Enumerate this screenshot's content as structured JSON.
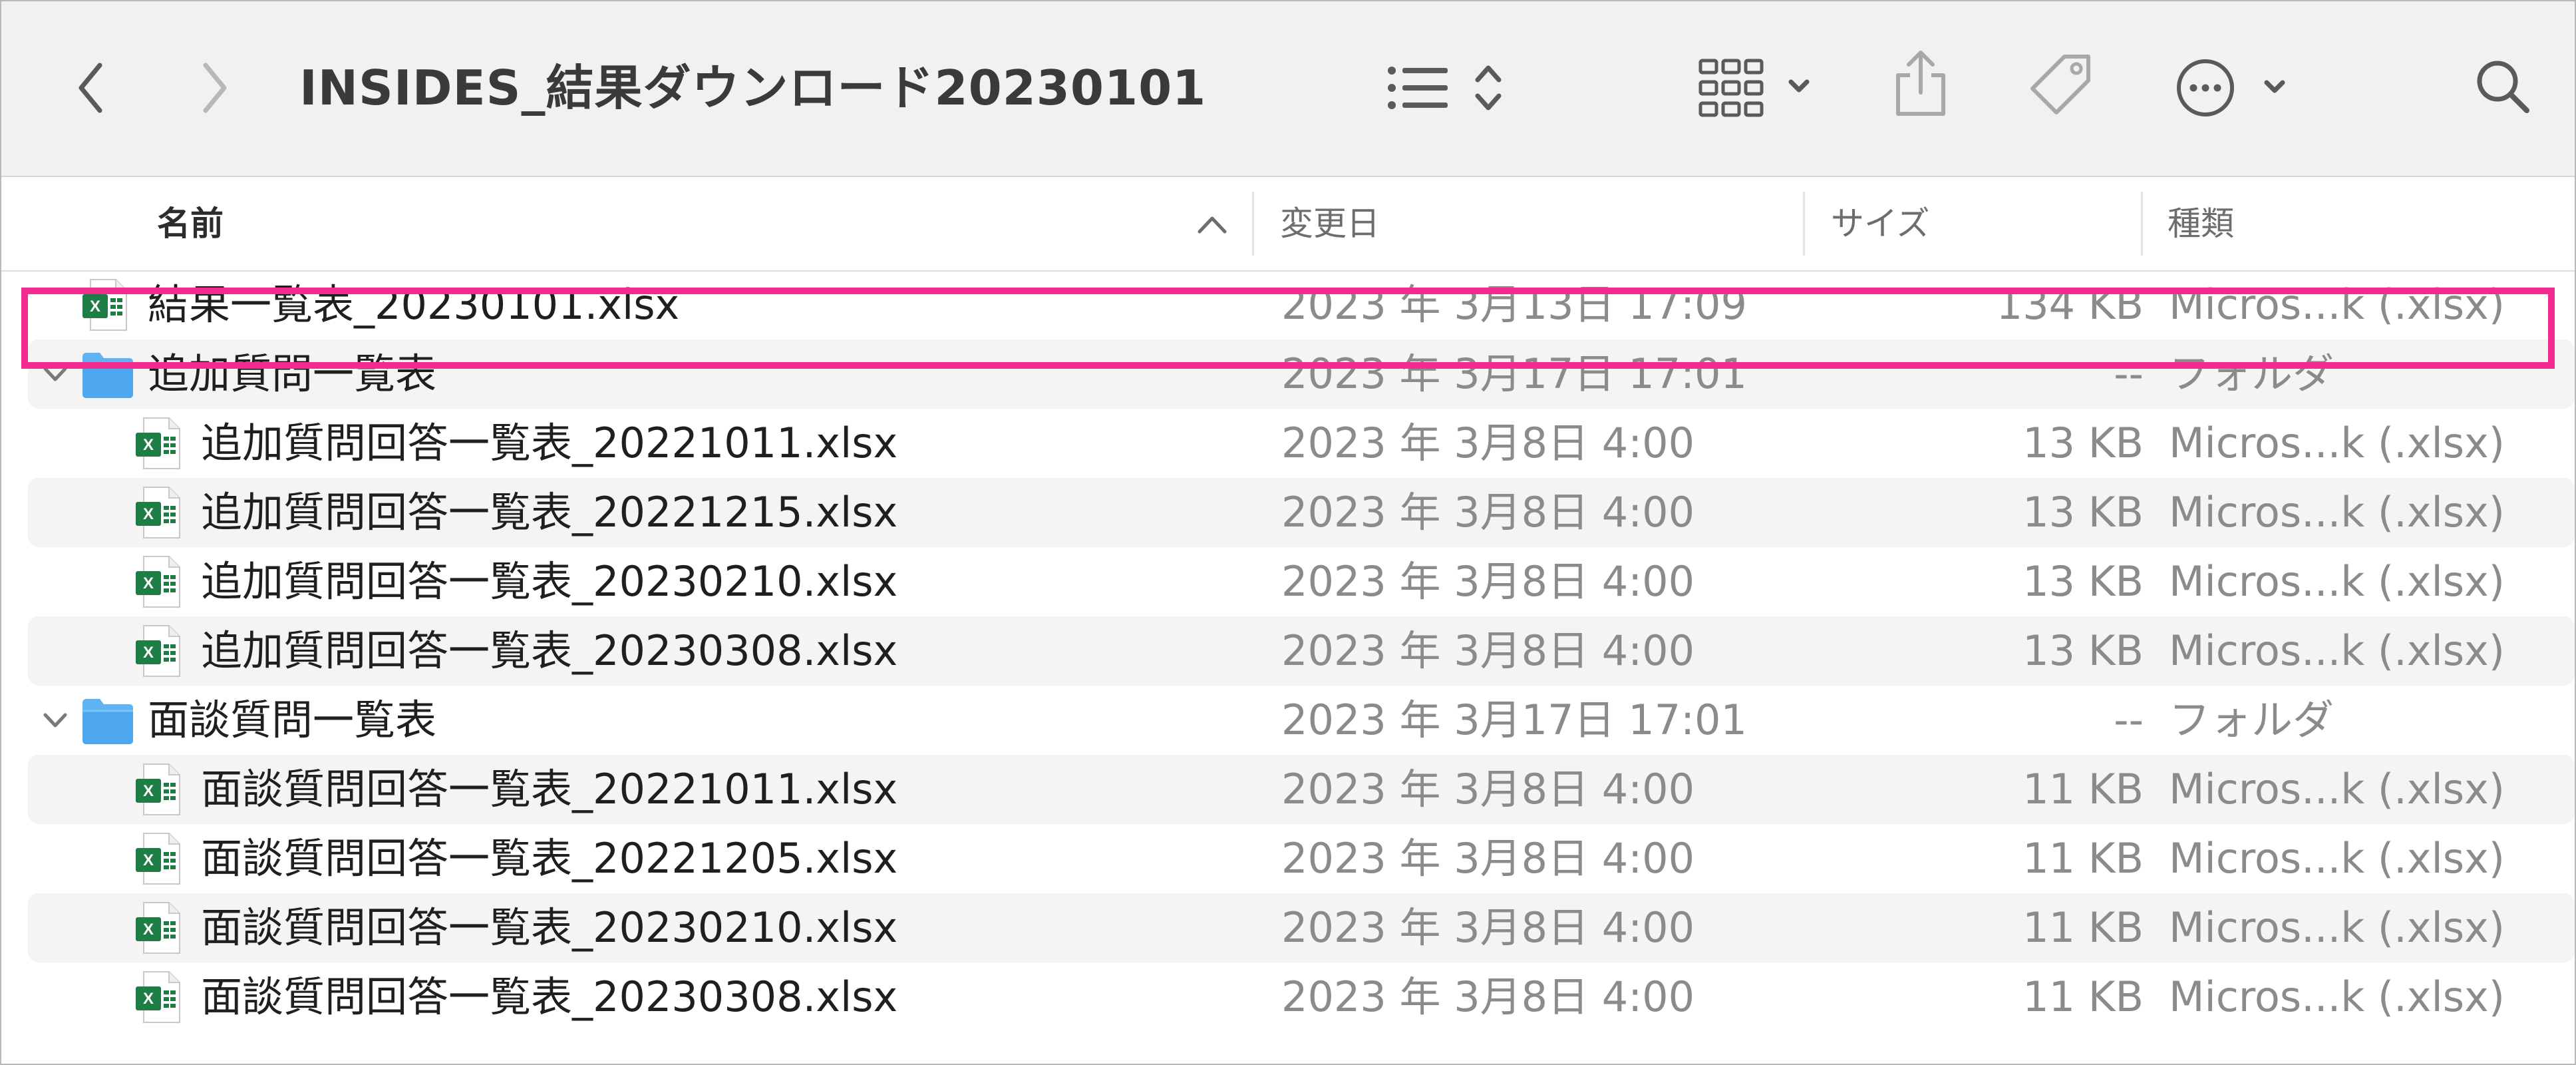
{
  "toolbar": {
    "title": "INSIDES_結果ダウンロード20230101",
    "icons": [
      "back-icon",
      "forward-icon",
      "list-view-icon",
      "sort-icon",
      "grid-view-icon",
      "share-icon",
      "tag-icon",
      "more-icon",
      "search-icon"
    ]
  },
  "columns": {
    "name": "名前",
    "date": "変更日",
    "size": "サイズ",
    "kind": "種類"
  },
  "rows": [
    {
      "name": "結果一覧表_20230101.xlsx",
      "date": "2023 年 3月13日 17:09",
      "size": "134 KB",
      "kind": "Micros...k (.xlsx)",
      "type": "xlsx",
      "indent": 0
    },
    {
      "name": "追加質問一覧表",
      "date": "2023 年 3月17日 17:01",
      "size": "--",
      "kind": "フォルダ",
      "type": "folder",
      "indent": 0
    },
    {
      "name": "追加質問回答一覧表_20221011.xlsx",
      "date": "2023 年 3月8日 4:00",
      "size": "13 KB",
      "kind": "Micros...k (.xlsx)",
      "type": "xlsx",
      "indent": 1
    },
    {
      "name": "追加質問回答一覧表_20221215.xlsx",
      "date": "2023 年 3月8日 4:00",
      "size": "13 KB",
      "kind": "Micros...k (.xlsx)",
      "type": "xlsx",
      "indent": 1
    },
    {
      "name": "追加質問回答一覧表_20230210.xlsx",
      "date": "2023 年 3月8日 4:00",
      "size": "13 KB",
      "kind": "Micros...k (.xlsx)",
      "type": "xlsx",
      "indent": 1
    },
    {
      "name": "追加質問回答一覧表_20230308.xlsx",
      "date": "2023 年 3月8日 4:00",
      "size": "13 KB",
      "kind": "Micros...k (.xlsx)",
      "type": "xlsx",
      "indent": 1
    },
    {
      "name": "面談質問一覧表",
      "date": "2023 年 3月17日 17:01",
      "size": "--",
      "kind": "フォルダ",
      "type": "folder",
      "indent": 0
    },
    {
      "name": "面談質問回答一覧表_20221011.xlsx",
      "date": "2023 年 3月8日 4:00",
      "size": "11 KB",
      "kind": "Micros...k (.xlsx)",
      "type": "xlsx",
      "indent": 1
    },
    {
      "name": "面談質問回答一覧表_20221205.xlsx",
      "date": "2023 年 3月8日 4:00",
      "size": "11 KB",
      "kind": "Micros...k (.xlsx)",
      "type": "xlsx",
      "indent": 1
    },
    {
      "name": "面談質問回答一覧表_20230210.xlsx",
      "date": "2023 年 3月8日 4:00",
      "size": "11 KB",
      "kind": "Micros...k (.xlsx)",
      "type": "xlsx",
      "indent": 1
    },
    {
      "name": "面談質問回答一覧表_20230308.xlsx",
      "date": "2023 年 3月8日 4:00",
      "size": "11 KB",
      "kind": "Micros...k (.xlsx)",
      "type": "xlsx",
      "indent": 1
    }
  ],
  "colors": {
    "highlight": "#f22c8e",
    "folder": "#4ea8f0",
    "excel": "#1e7d45"
  }
}
